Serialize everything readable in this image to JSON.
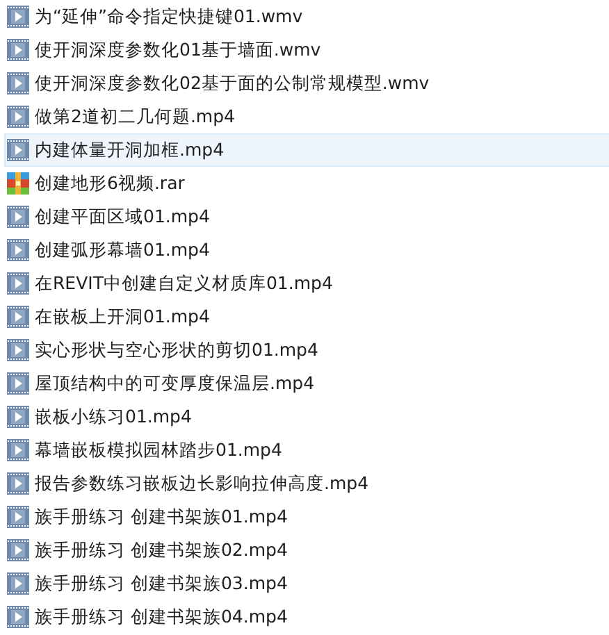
{
  "files": [
    {
      "name": "为“延伸”命令指定快捷键01.wmv",
      "kind": "video",
      "highlighted": false
    },
    {
      "name": "使开洞深度参数化01基于墙面.wmv",
      "kind": "video",
      "highlighted": false
    },
    {
      "name": "使开洞深度参数化02基于面的公制常规模型.wmv",
      "kind": "video",
      "highlighted": false
    },
    {
      "name": "做第2道初二几何题.mp4",
      "kind": "video",
      "highlighted": false
    },
    {
      "name": "内建体量开洞加框.mp4",
      "kind": "video",
      "highlighted": true
    },
    {
      "name": "创建地形6视频.rar",
      "kind": "archive",
      "highlighted": false
    },
    {
      "name": "创建平面区域01.mp4",
      "kind": "video",
      "highlighted": false
    },
    {
      "name": "创建弧形幕墙01.mp4",
      "kind": "video",
      "highlighted": false
    },
    {
      "name": "在REVIT中创建自定义材质库01.mp4",
      "kind": "video",
      "highlighted": false
    },
    {
      "name": "在嵌板上开洞01.mp4",
      "kind": "video",
      "highlighted": false
    },
    {
      "name": "实心形状与空心形状的剪切01.mp4",
      "kind": "video",
      "highlighted": false
    },
    {
      "name": "屋顶结构中的可变厚度保温层.mp4",
      "kind": "video",
      "highlighted": false
    },
    {
      "name": "嵌板小练习01.mp4",
      "kind": "video",
      "highlighted": false
    },
    {
      "name": "幕墙嵌板模拟园林踏步01.mp4",
      "kind": "video",
      "highlighted": false
    },
    {
      "name": "报告参数练习嵌板边长影响拉伸高度.mp4",
      "kind": "video",
      "highlighted": false
    },
    {
      "name": "族手册练习 创建书架族01.mp4",
      "kind": "video",
      "highlighted": false
    },
    {
      "name": "族手册练习 创建书架族02.mp4",
      "kind": "video",
      "highlighted": false
    },
    {
      "name": "族手册练习 创建书架族03.mp4",
      "kind": "video",
      "highlighted": false
    },
    {
      "name": "族手册练习 创建书架族04.mp4",
      "kind": "video",
      "highlighted": false
    }
  ]
}
